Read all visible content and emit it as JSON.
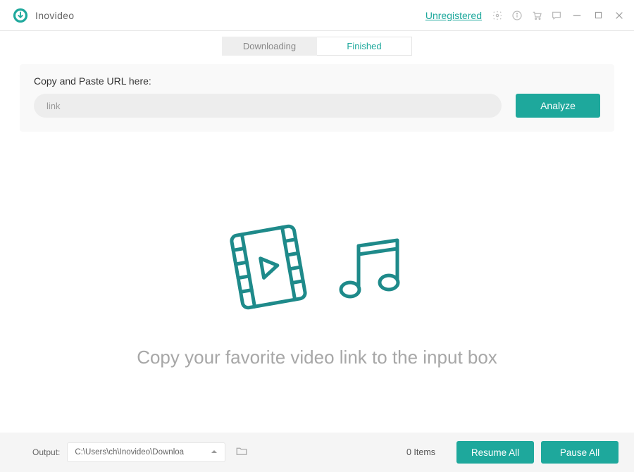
{
  "titlebar": {
    "app_name": "Inovideo",
    "unregistered_label": "Unregistered"
  },
  "tabs": {
    "downloading": "Downloading",
    "finished": "Finished"
  },
  "url_panel": {
    "label": "Copy and Paste URL here:",
    "placeholder": "link",
    "analyze_label": "Analyze"
  },
  "center": {
    "prompt": "Copy your favorite video link to the input box"
  },
  "bottombar": {
    "output_label": "Output:",
    "output_path": "C:\\Users\\ch\\Inovideo\\Downloa",
    "items_count": "0 Items",
    "resume_label": "Resume All",
    "pause_label": "Pause All"
  },
  "colors": {
    "accent": "#1ea89c"
  }
}
